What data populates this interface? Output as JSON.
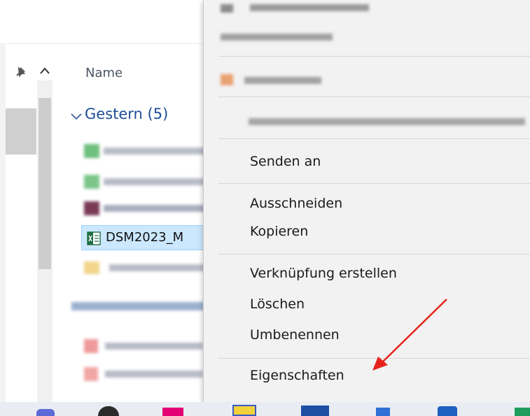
{
  "explorer": {
    "column_header": "Name",
    "group_label": "Gestern (5)",
    "selected_file": "DSM2023_M"
  },
  "context_menu": {
    "items": [
      {
        "label": "Senden an"
      },
      {
        "label": "Ausschneiden"
      },
      {
        "label": "Kopieren"
      },
      {
        "label": "Verknüpfung erstellen"
      },
      {
        "label": "Löschen"
      },
      {
        "label": "Umbenennen"
      },
      {
        "label": "Eigenschaften"
      }
    ]
  },
  "annotation": {
    "arrow_color": "#e5231b"
  }
}
